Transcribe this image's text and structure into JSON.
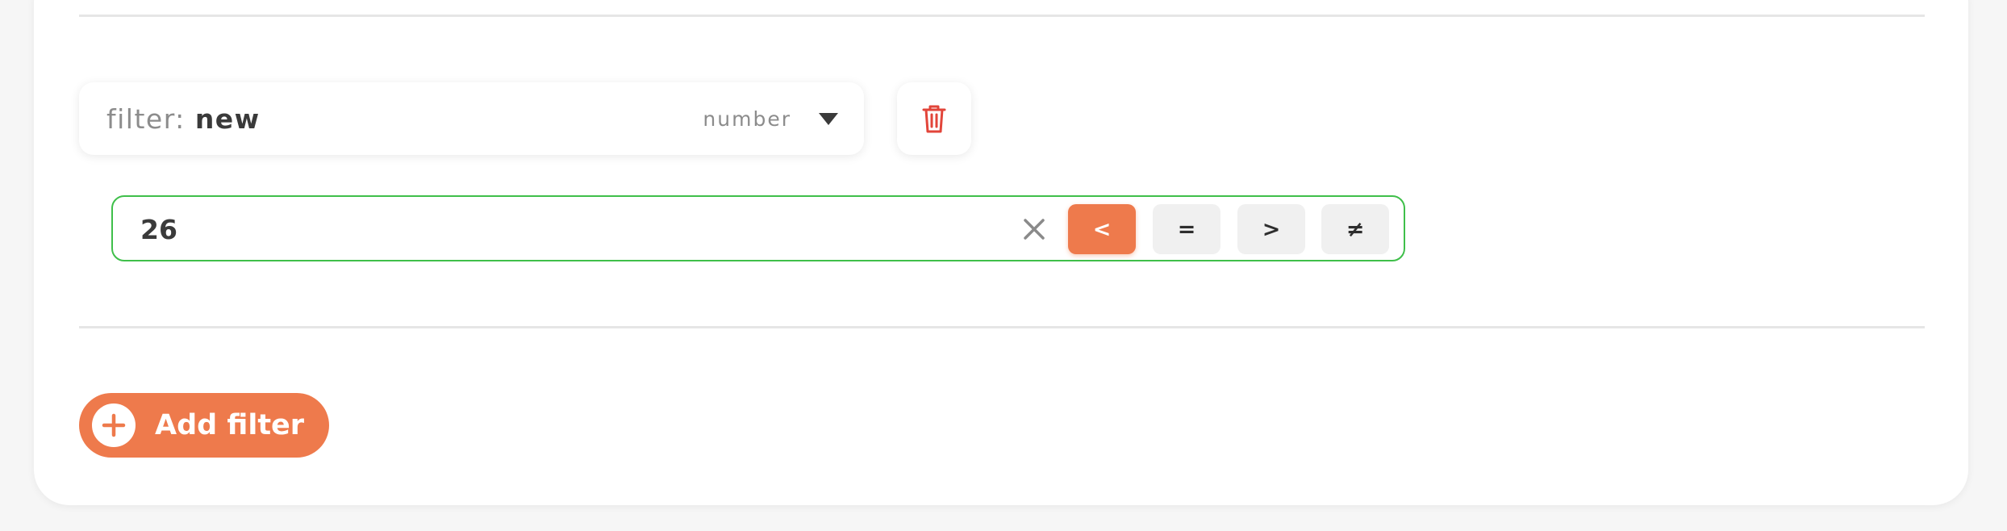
{
  "colors": {
    "accent": "#ee7a4c",
    "valid_border": "#3fbf4a",
    "delete_red": "#e2453a"
  },
  "filter": {
    "prefix": "filter:",
    "name": "new",
    "type": "number",
    "dropdown_icon": "caret-down-icon",
    "delete_icon": "trash-icon"
  },
  "value_input": {
    "value": "26",
    "clear_icon": "close-icon"
  },
  "operators": [
    {
      "label": "<",
      "selected": true
    },
    {
      "label": "=",
      "selected": false
    },
    {
      "label": ">",
      "selected": false
    },
    {
      "label": "≠",
      "selected": false
    }
  ],
  "add_filter": {
    "label": "Add filter",
    "icon": "plus-circle-icon"
  }
}
